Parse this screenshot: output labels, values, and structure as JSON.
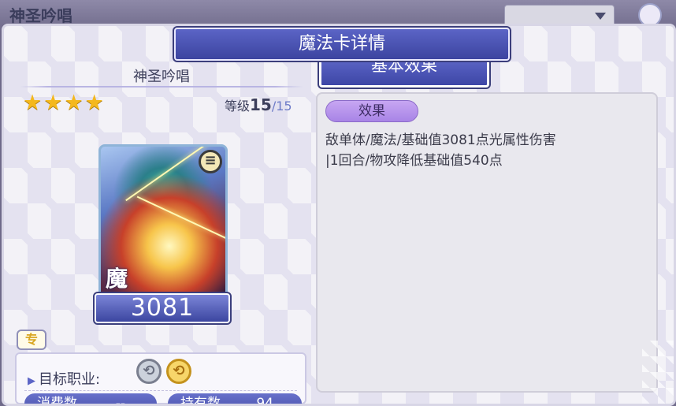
{
  "background": {
    "title": "神圣吟唱"
  },
  "dialog": {
    "title": "魔法卡详情"
  },
  "card": {
    "name": "神圣吟唱",
    "stars": 4,
    "star_glyph": "★",
    "level_label": "等级",
    "level_current": "15",
    "level_sep_max": "/15",
    "type_label": "魔",
    "value": "3081",
    "badge_icon": "menu-icon",
    "exclusive_label": "专"
  },
  "info": {
    "job_label": "目标职业:",
    "job_icons": [
      "silver-swap-icon",
      "gold-swap-icon"
    ],
    "consume_label": "消费数",
    "consume_value": "--",
    "own_label": "持有数",
    "own_value": "94"
  },
  "effects": {
    "tab_label": "基本效果",
    "tag_label": "效果",
    "text": "敌单体/魔法/基础值3081点光属性伤害\n|1回合/物攻降低基础值540点"
  },
  "colors": {
    "accent": "#4951a8",
    "star": "#f4b81d",
    "tag": "#b292ec"
  }
}
